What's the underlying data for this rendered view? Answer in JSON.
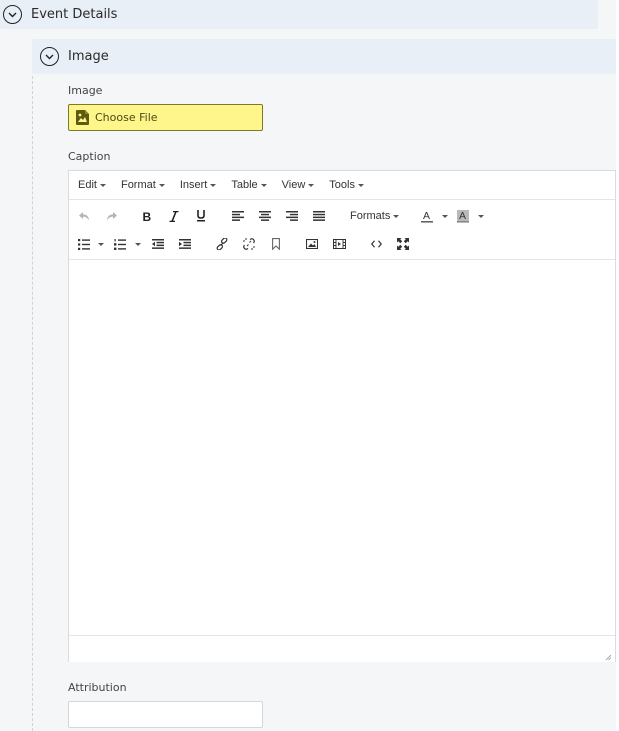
{
  "sections": {
    "outer": {
      "title": "Event Details",
      "expanded": true
    },
    "inner": {
      "title": "Image",
      "expanded": true
    }
  },
  "image_field": {
    "label": "Image",
    "button_label": "Choose File",
    "button_icon": "image-file-icon"
  },
  "caption_field": {
    "label": "Caption",
    "menubar": [
      "Edit",
      "Format",
      "Insert",
      "Table",
      "View",
      "Tools"
    ],
    "toolbar_row1": [
      "undo",
      "redo",
      "bold",
      "italic",
      "underline",
      "align-left",
      "align-center",
      "align-right",
      "align-justify",
      "formats",
      "text-color",
      "background-color"
    ],
    "toolbar_row2": [
      "bullet-list",
      "numbered-list",
      "outdent",
      "indent",
      "link",
      "unlink",
      "bookmark",
      "image",
      "media",
      "source-code",
      "fullscreen"
    ],
    "formats_label": "Formats",
    "text_color_glyph": "A",
    "bg_color_glyph": "A",
    "content": ""
  },
  "attribution_field": {
    "label": "Attribution",
    "value": "",
    "placeholder": ""
  },
  "colors": {
    "header_bg": "#e8eff7",
    "choose_file_bg": "#fef68a",
    "choose_file_border": "#7d7a25"
  }
}
